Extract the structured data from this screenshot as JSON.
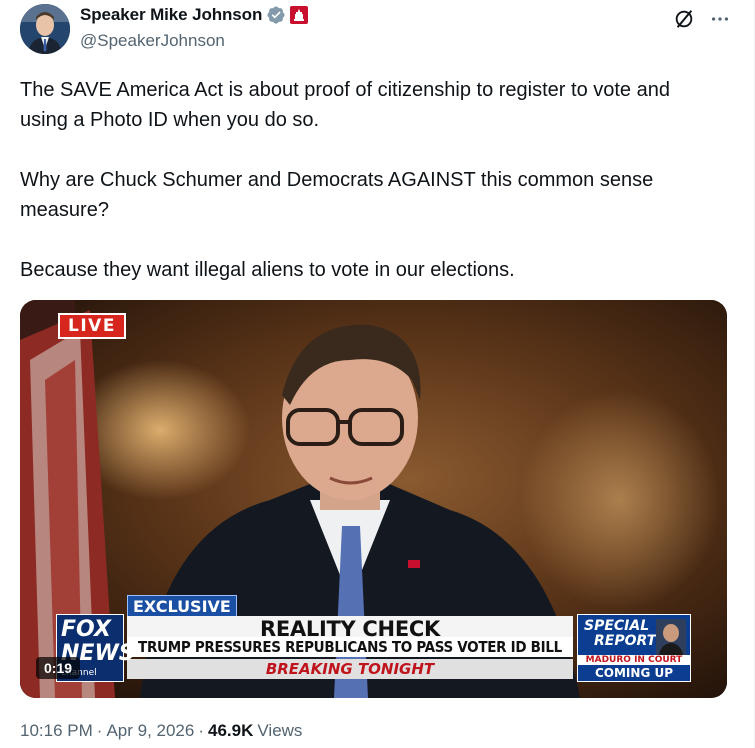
{
  "author": {
    "display_name": "Speaker Mike Johnson",
    "handle": "@SpeakerJohnson",
    "verified_icon": "verified-badge-icon",
    "affiliation_icon": "capitol-affiliation-icon"
  },
  "header_actions": {
    "grok_icon": "grok-icon",
    "more_icon": "more-horizontal-icon"
  },
  "tweet": {
    "paragraphs": [
      "The SAVE America Act is about proof of citizenship to register to vote and using a Photo ID when you do so.",
      "Why are Chuck Schumer and Democrats AGAINST this common sense measure?",
      "Because they want illegal aliens to vote in our elections."
    ]
  },
  "video": {
    "live_label": "LIVE",
    "exclusive_label": "EXCLUSIVE",
    "headline": "REALITY CHECK",
    "subheadline": "TRUMP PRESSURES REPUBLICANS TO PASS VOTER ID BILL",
    "breaking": "BREAKING TONIGHT",
    "network_logo_line1": "FOX",
    "network_logo_line2": "NEWS",
    "network_logo_line3": "channel",
    "special_line1": "SPECIAL",
    "special_line2": "REPORT",
    "special_ticker": "MADURO IN COURT",
    "special_coming": "COMING UP",
    "duration": "0:19"
  },
  "footer": {
    "time": "10:16 PM",
    "separator": "·",
    "date": "Apr 9, 2026",
    "views_count": "46.9K",
    "views_label": "Views"
  },
  "colors": {
    "verified": "#1d9bf0",
    "secondary_text": "#536471",
    "fox_red": "#c0141c",
    "fox_blue": "#0b2f6e"
  }
}
